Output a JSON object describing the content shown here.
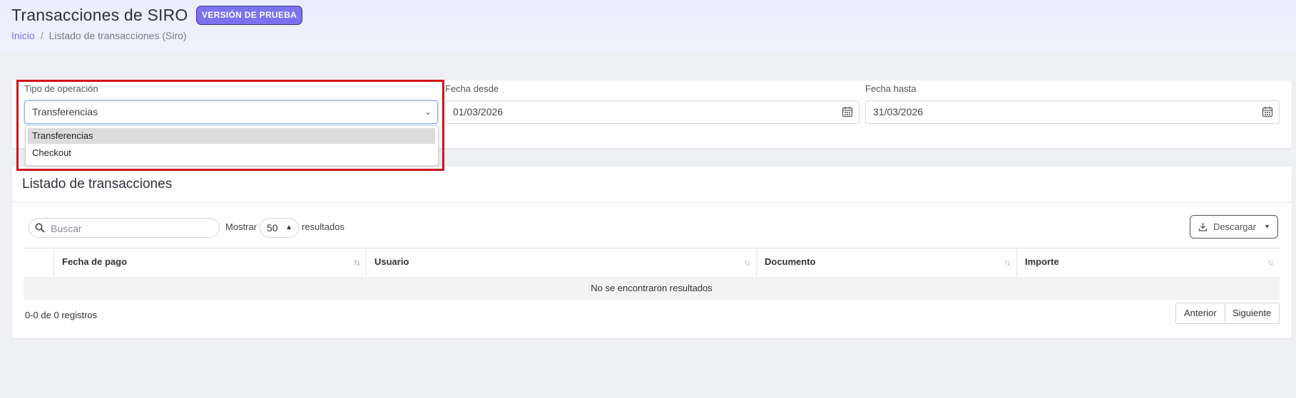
{
  "header": {
    "title": "Transacciones de SIRO",
    "badge": "VERSIÓN DE PRUEBA",
    "breadcrumb": {
      "home": "Inicio",
      "separator": "/",
      "current": "Listado de transacciones (Siro)"
    }
  },
  "filters": {
    "operation_type": {
      "label": "Tipo de operación",
      "value": "Transferencias",
      "options": [
        "Transferencias",
        "Checkout"
      ],
      "selected_option": "Transferencias"
    },
    "date_from": {
      "label": "Fecha desde",
      "value": "01/03/2026"
    },
    "date_to": {
      "label": "Fecha hasta",
      "value": "31/03/2026"
    }
  },
  "list": {
    "title": "Listado de transacciones",
    "search_placeholder": "Buscar",
    "show_label": "Mostrar",
    "page_size": "50",
    "results_label": "resultados",
    "download_label": "Descargar",
    "columns": [
      "",
      "Fecha de pago",
      "Usuario",
      "Documento",
      "Importe"
    ],
    "empty_message": "No se encontraron resultados",
    "record_count": "0-0 de 0 registros",
    "prev_label": "Anterior",
    "next_label": "Siguiente"
  },
  "colors": {
    "accent": "#7b72f0",
    "highlight_border": "#d0121c",
    "header_bg": "#ececff",
    "page_bg": "#eef0f3"
  }
}
